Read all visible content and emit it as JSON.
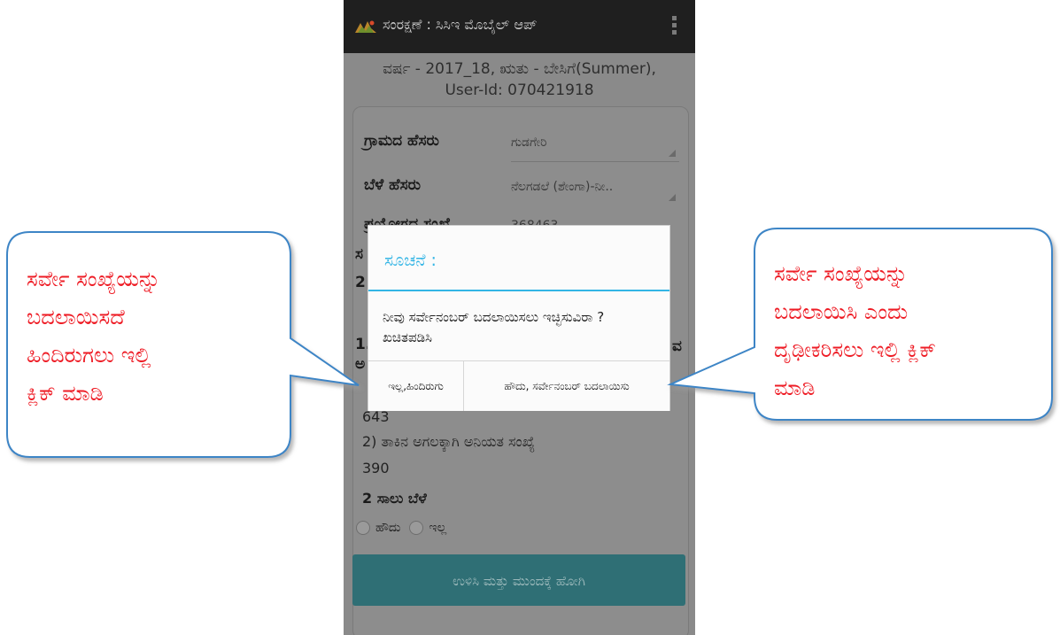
{
  "app": {
    "title": "ಸಂರಕ್ಷಣೆ : ಸಿಸಿಇ ಮೊಬೈಲ್ ಆಪ್"
  },
  "header": {
    "season_line": "ವರ್ಷ - 2017_18, ಋತು - ಬೇಸಿಗೆ(Summer),",
    "user_line": "User-Id: 070421918"
  },
  "form": {
    "village_label": "ಗ್ರಾಮದ ಹೆಸರು",
    "village_value": "ಗುಡಗೇರಿ",
    "crop_label": "ಬೆಳೆ ಹೆಸರು",
    "crop_value": "ನೆಲಗಡಲೆ (ಶೇಂಗಾ)-ನೀ..",
    "experiment_label": "ಪ್ರಯೋಗದ ಸಂಖ್ಯೆ",
    "experiment_value": "368463",
    "frag_label": "ಸ",
    "frag_value": "2",
    "frag_one": "1.",
    "frag_a": "ಅ",
    "frag_va": "ವ",
    "random_one_value": "643",
    "random_two_label": "2) ತಾಕಿನ ಅಗಲಕ್ಕಾಗಿ ಅನಿಯತ ಸಂಖ್ಯೆ",
    "random_two_value": "390",
    "two_row_label": "2 ಸಾಲು ಬೆಳೆ",
    "radio_yes": "ಹೌದು",
    "radio_no": "ಇಲ್ಲ",
    "save_button": "ಉಳಿಸಿ ಮತ್ತು ಮುಂದಕ್ಕೆ ಹೋಗಿ"
  },
  "dialog": {
    "title": "ಸೂಚನೆ :",
    "message": "ನೀವು ಸರ್ವೇನಂಬರ್ ಬದಲಾಯಿಸಲು ಇಚ್ಛಿಸುವಿರಾ ? ಖಚಿತಪಡಿಸಿ",
    "no_button": "ಇಲ್ಲ,ಹಿಂದಿರುಗು",
    "yes_button": "ಹೌದು, ಸರ್ವೇನಂಬರ್ ಬದಲಾಯಿಸು"
  },
  "callouts": {
    "left": [
      "ಸರ್ವೇ ಸಂಖ್ಯೆಯನ್ನು",
      "ಬದಲಾಯಿಸದೆ",
      "ಹಿಂದಿರುಗಲು ಇಲ್ಲಿ",
      "ಕ್ಲಿಕ್ ಮಾಡಿ"
    ],
    "right": [
      "ಸರ್ವೇ ಸಂಖ್ಯೆಯನ್ನು",
      "ಬದಲಾಯಿಸಿ ಎಂದು",
      "ದೃಢೀಕರಿಸಲು ಇಲ್ಲಿ ಕ್ಲಿಕ್",
      "ಮಾಡಿ"
    ]
  },
  "colors": {
    "callout_text": "#ee1c25",
    "callout_border": "#3d85c6",
    "dialog_accent": "#33b5e5",
    "save_button_bg": "#2f6f75"
  }
}
